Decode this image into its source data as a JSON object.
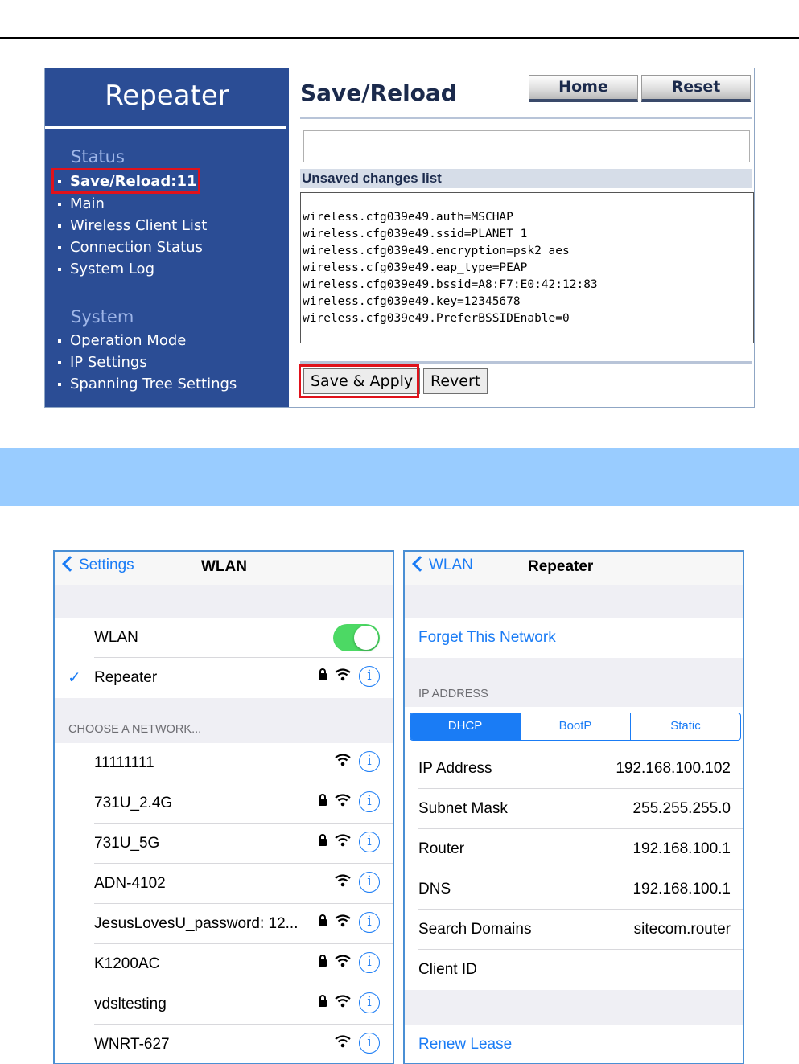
{
  "router": {
    "sidebar": {
      "title": "Repeater",
      "status_label": "Status",
      "status_items": [
        "Save/Reload:11",
        "Main",
        "Wireless Client List",
        "Connection Status",
        "System Log"
      ],
      "system_label": "System",
      "system_items": [
        "Operation Mode",
        "IP Settings",
        "Spanning Tree Settings"
      ]
    },
    "main": {
      "title": "Save/Reload",
      "home_button": "Home",
      "reset_button": "Reset",
      "changes_header": "Unsaved changes list",
      "changes": [
        "wireless.cfg039e49.auth=MSCHAP",
        "wireless.cfg039e49.ssid=PLANET 1",
        "wireless.cfg039e49.encryption=psk2 aes",
        "wireless.cfg039e49.eap_type=PEAP",
        "wireless.cfg039e49.bssid=A8:F7:E0:42:12:83",
        "wireless.cfg039e49.key=12345678",
        "wireless.cfg039e49.PreferBSSIDEnable=0"
      ],
      "save_apply_button": "Save & Apply",
      "revert_button": "Revert"
    }
  },
  "wlan_screen": {
    "back_label": "Settings",
    "title": "WLAN",
    "wlan_label": "WLAN",
    "wlan_enabled": true,
    "connected_network": "Repeater",
    "choose_label": "CHOOSE A NETWORK...",
    "networks": [
      {
        "name": "11111111",
        "locked": false
      },
      {
        "name": "731U_2.4G",
        "locked": true
      },
      {
        "name": "731U_5G",
        "locked": true
      },
      {
        "name": "ADN-4102",
        "locked": false
      },
      {
        "name": "JesusLovesU_password: 12...",
        "locked": true
      },
      {
        "name": "K1200AC",
        "locked": true
      },
      {
        "name": "vdsltesting",
        "locked": true
      },
      {
        "name": "WNRT-627",
        "locked": false
      }
    ]
  },
  "network_screen": {
    "back_label": "WLAN",
    "title": "Repeater",
    "forget_label": "Forget This Network",
    "ip_section_label": "IP ADDRESS",
    "segments": [
      "DHCP",
      "BootP",
      "Static"
    ],
    "selected_segment": "DHCP",
    "fields": [
      {
        "label": "IP Address",
        "value": "192.168.100.102"
      },
      {
        "label": "Subnet Mask",
        "value": "255.255.255.0"
      },
      {
        "label": "Router",
        "value": "192.168.100.1"
      },
      {
        "label": "DNS",
        "value": "192.168.100.1"
      },
      {
        "label": "Search Domains",
        "value": "sitecom.router"
      },
      {
        "label": "Client ID",
        "value": ""
      }
    ],
    "renew_label": "Renew Lease"
  },
  "colors": {
    "sidebar_bg": "#2b4d95",
    "highlight_red": "#e0121b",
    "ios_blue": "#1a7cf5",
    "toggle_green": "#4cd964",
    "band_blue": "#99ccff"
  }
}
